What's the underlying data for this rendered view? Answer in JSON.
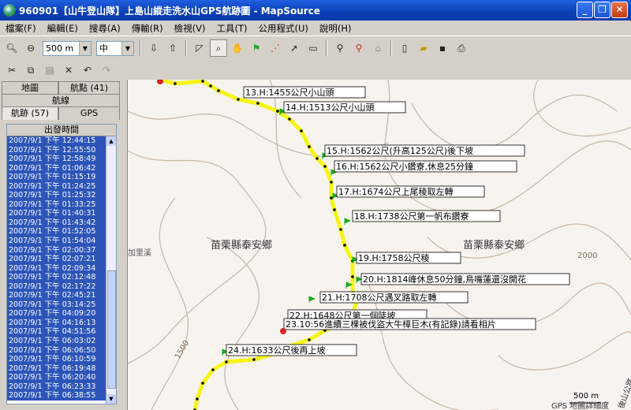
{
  "window": {
    "title": "960901【山牛登山隊】上島山縱走洗水山GPS航跡圖 - MapSource",
    "buttons": [
      "_",
      "❐",
      "✕"
    ]
  },
  "menu": [
    "檔案(F)",
    "編輯(E)",
    "搜尋(A)",
    "傳輸(R)",
    "檢視(V)",
    "工具(T)",
    "公用程式(U)",
    "說明(H)"
  ],
  "toolbar": {
    "zoom_value": "500 m",
    "detail_value": "中"
  },
  "left_panel": {
    "tabs_row1": [
      "地圖",
      "航點 (41)"
    ],
    "tabs_row2": [
      "航線"
    ],
    "tabs_row3": [
      "航跡 (57)",
      "GPS"
    ],
    "column_header": "出發時間",
    "rows": [
      "2007/9/1 下午 12:44:15",
      "2007/9/1 下午 12:55:50",
      "2007/9/1 下午 12:58:49",
      "2007/9/1 下午 01:06:42",
      "2007/9/1 下午 01:15:19",
      "2007/9/1 下午 01:24:25",
      "2007/9/1 下午 01:25:32",
      "2007/9/1 下午 01:33:25",
      "2007/9/1 下午 01:40:31",
      "2007/9/1 下午 01:43:42",
      "2007/9/1 下午 01:52:05",
      "2007/9/1 下午 01:54:04",
      "2007/9/1 下午 02:00:37",
      "2007/9/1 下午 02:07:21",
      "2007/9/1 下午 02:09:34",
      "2007/9/1 下午 02:12:48",
      "2007/9/1 下午 02:17:22",
      "2007/9/1 下午 02:45:21",
      "2007/9/1 下午 03:14:25",
      "2007/9/1 下午 04:09:20",
      "2007/9/1 下午 04:16:13",
      "2007/9/1 下午 04:51:56",
      "2007/9/1 下午 06:03:02",
      "2007/9/1 下午 06:06:50",
      "2007/9/1 下午 06:10:59",
      "2007/9/1 下午 06:19:48",
      "2007/9/1 下午 06:20:40",
      "2007/9/1 下午 06:23:33",
      "2007/9/1 下午 06:38:55"
    ]
  },
  "map": {
    "waypoints": [
      "13.H:1455公尺小山頭",
      "14.H:1513公尺小山頭",
      "15.H:1562公尺(升高125公尺)後下坡",
      "16.H:1562公尺小鑽寮,休息25分鐘",
      "17.H:1674公尺上尾稜取左轉",
      "18.H:1738公尺第一帆布鑽寮",
      "19.H:1758公尺稜",
      "20.H:1814峰休息50分鐘,鳥嘴蓮還沒開花",
      "21.H:1708公尺遇叉路取左轉",
      "22.H:1648公尺第一個陡坡",
      "23.10:56進續三棵被伐盜大牛樟巨木(有記錄)請看相片",
      "24.H:1633公尺後再上坡"
    ],
    "region_labels": [
      "苗栗縣泰安鄉",
      "苗栗縣泰安鄉"
    ],
    "river_label": "加里溪",
    "contour_labels": [
      "1500",
      "2000"
    ],
    "scale_label": "500 m",
    "footer_label": "GPS 地圖詳細度",
    "road_label": "後山公路",
    "colors": {
      "track": "#f5f514",
      "trackdot": "#000000",
      "flag": "#22aa22",
      "labelborder": "#000000"
    }
  }
}
